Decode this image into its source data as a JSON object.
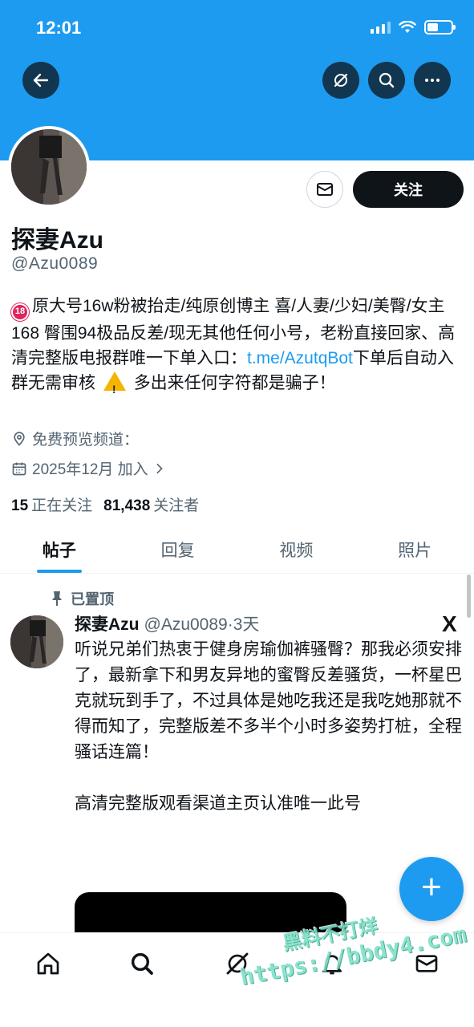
{
  "status_bar": {
    "time": "12:01"
  },
  "header": {
    "back_icon": "arrow-left-icon",
    "grok_icon": "grok-icon",
    "search_icon": "search-icon",
    "more_icon": "more-horizontal-icon"
  },
  "profile": {
    "name": "探妻Azu",
    "handle": "@Azu0089",
    "follow_label": "关注",
    "bio": {
      "badge": "18",
      "part1": "原大号16w粉被抬走/纯原创博主 喜/人妻/少妇/美臀/女主168 臀围94极品反差/现无其他任何小号，老粉直接回家、高清完整版电报群唯一下单入口：",
      "link": "t.me/AzutqBot",
      "part2": "下单后自动入群无需审核",
      "part3": "多出来任何字符都是骗子！"
    },
    "location": "免费预览频道：",
    "joined": "2025年12月 加入",
    "following_count": "15",
    "following_label": "正在关注",
    "followers_count": "81,438",
    "followers_label": "关注者"
  },
  "tabs": [
    {
      "label": "帖子",
      "active": true
    },
    {
      "label": "回复",
      "active": false
    },
    {
      "label": "视频",
      "active": false
    },
    {
      "label": "照片",
      "active": false
    }
  ],
  "post": {
    "pinned_label": "已置顶",
    "name": "探妻Azu",
    "meta": "@Azu0089·3天",
    "body": "听说兄弟们热衷于健身房瑜伽裤骚臀？那我必须安排了，最新拿下和男友异地的蜜臀反差骚货，一杯星巴克就玩到手了，不过具体是她吃我还是我吃她那就不得而知了，完整版差不多半个小时多姿势打桩，全程骚话连篇！\n\n高清完整版观看渠道主页认准唯一此号",
    "x_logo": "X"
  },
  "fab_label": "+",
  "bottom_nav": [
    "home-icon",
    "search-icon",
    "grok-icon",
    "notifications-icon",
    "messages-icon"
  ],
  "watermark": {
    "line1": "黑料不打烊",
    "line2": "https://bbdy4.com"
  },
  "colors": {
    "accent": "#1d9bf0",
    "text": "#0f1419",
    "muted": "#536471"
  }
}
